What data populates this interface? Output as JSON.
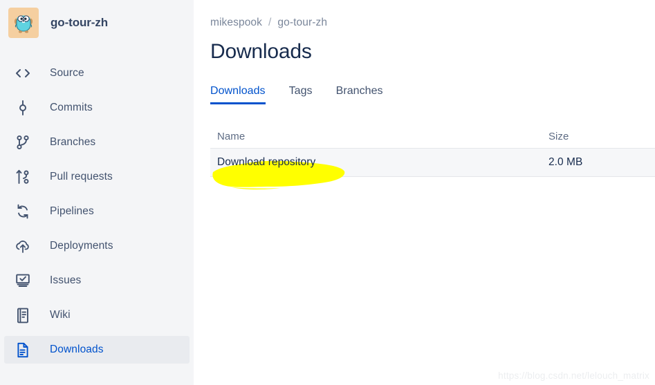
{
  "sidebar": {
    "repo": {
      "name": "go-tour-zh",
      "avatar_icon": "go-gopher-logo",
      "avatar_bg": "#f5cfa0"
    },
    "items": [
      {
        "label": "Source",
        "icon": "code-brackets-icon",
        "selected": false
      },
      {
        "label": "Commits",
        "icon": "commit-node-icon",
        "selected": false
      },
      {
        "label": "Branches",
        "icon": "branch-icon",
        "selected": false
      },
      {
        "label": "Pull requests",
        "icon": "pull-request-icon",
        "selected": false
      },
      {
        "label": "Pipelines",
        "icon": "pipeline-refresh-icon",
        "selected": false
      },
      {
        "label": "Deployments",
        "icon": "cloud-upload-icon",
        "selected": false
      },
      {
        "label": "Issues",
        "icon": "monitor-check-icon",
        "selected": false
      },
      {
        "label": "Wiki",
        "icon": "document-lines-icon",
        "selected": false
      },
      {
        "label": "Downloads",
        "icon": "file-download-icon",
        "selected": true
      }
    ]
  },
  "main": {
    "breadcrumb": {
      "owner": "mikespook",
      "separator": "/",
      "repo": "go-tour-zh"
    },
    "page_title": "Downloads",
    "tabs": [
      {
        "label": "Downloads",
        "active": true
      },
      {
        "label": "Tags",
        "active": false
      },
      {
        "label": "Branches",
        "active": false
      }
    ],
    "table": {
      "columns": [
        {
          "key": "name",
          "label": "Name"
        },
        {
          "key": "size",
          "label": "Size"
        }
      ],
      "rows": [
        {
          "name": "Download repository",
          "size": "2.0 MB"
        }
      ]
    },
    "annotation": {
      "type": "highlighter-stroke",
      "color": "#ffff00",
      "target": "Download repository"
    }
  },
  "watermark": "https://blog.csdn.net/lelouch_matrix",
  "colors": {
    "accent": "#0052cc",
    "sidebar_bg": "#f4f5f7",
    "selected_bg": "#e9ebef",
    "text_primary": "#172b4d",
    "text_muted": "#7a869a",
    "row_bg": "#f6f7f9",
    "highlight": "#ffff00"
  }
}
